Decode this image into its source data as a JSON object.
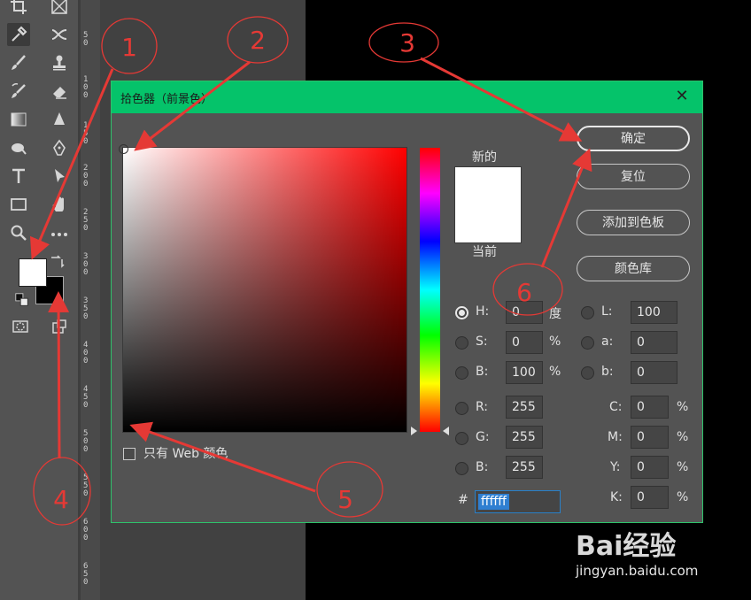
{
  "ruler": {
    "labels": [
      "5\n0",
      "1\n0\n0",
      "1\n5\n0",
      "2\n0\n0",
      "2\n5\n0",
      "3\n0\n0",
      "3\n5\n0",
      "4\n0\n0",
      "4\n5\n0",
      "5\n0\n0",
      "5\n5\n0",
      "6\n0\n0",
      "6\n5\n0"
    ]
  },
  "dialog": {
    "title": "拾色器（前景色）",
    "new_label": "新的",
    "current_label": "当前",
    "buttons": {
      "ok": "确定",
      "reset": "复位",
      "add_swatch": "添加到色板",
      "libraries": "颜色库"
    },
    "web_only_label": "只有 Web 颜色",
    "fields": {
      "H": {
        "label": "H:",
        "value": "0",
        "unit": "度"
      },
      "S": {
        "label": "S:",
        "value": "0",
        "unit": "%"
      },
      "B": {
        "label": "B:",
        "value": "100",
        "unit": "%"
      },
      "R": {
        "label": "R:",
        "value": "255"
      },
      "G": {
        "label": "G:",
        "value": "255"
      },
      "Bb": {
        "label": "B:",
        "value": "255"
      },
      "L": {
        "label": "L:",
        "value": "100"
      },
      "a": {
        "label": "a:",
        "value": "0"
      },
      "b": {
        "label": "b:",
        "value": "0"
      },
      "C": {
        "label": "C:",
        "value": "0",
        "unit": "%"
      },
      "M": {
        "label": "M:",
        "value": "0",
        "unit": "%"
      },
      "Y": {
        "label": "Y:",
        "value": "0",
        "unit": "%"
      },
      "K": {
        "label": "K:",
        "value": "0",
        "unit": "%"
      }
    },
    "hex_label": "#",
    "hex_value": "ffffff"
  },
  "annotations": {
    "n1": "1",
    "n2": "2",
    "n3": "3",
    "n4": "4",
    "n5": "5",
    "n6": "6"
  },
  "watermark": {
    "brand": "Bai经验",
    "url": "jingyan.baidu.com"
  },
  "colors": {
    "titlebar": "#05c36a",
    "annotation": "#e53935",
    "foreground": "#ffffff",
    "background": "#000000"
  }
}
